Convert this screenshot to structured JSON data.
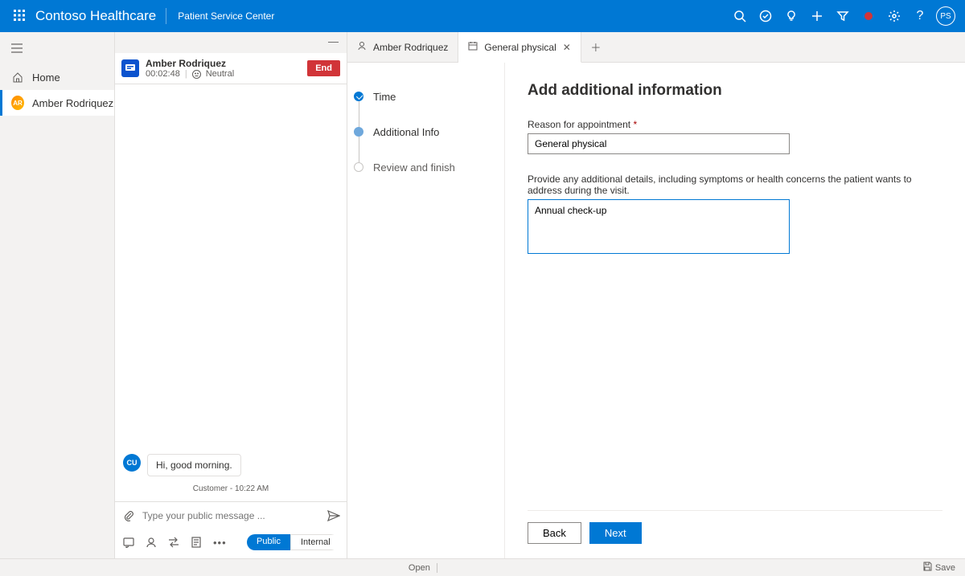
{
  "header": {
    "brand": "Contoso Healthcare",
    "subtitle": "Patient Service Center",
    "avatar": "PS"
  },
  "nav": {
    "home": "Home",
    "patient": "Amber Rodriquez",
    "patient_initials": "AR"
  },
  "chat": {
    "name": "Amber Rodriquez",
    "timer": "00:02:48",
    "sentiment": "Neutral",
    "end": "End",
    "msg_avatar": "CU",
    "msg_text": "Hi, good morning.",
    "msg_footer": "Customer - 10:22 AM",
    "placeholder": "Type your public message ...",
    "toggle_public": "Public",
    "toggle_internal": "Internal"
  },
  "tabs": {
    "t1": "Amber Rodriquez",
    "t2": "General physical"
  },
  "steps": {
    "s1": "Time",
    "s2": "Additional Info",
    "s3": "Review and finish"
  },
  "form": {
    "title": "Add additional information",
    "reason_label": "Reason for appointment",
    "reason_value": "General physical",
    "details_label": "Provide any additional details, including symptoms or health concerns the patient wants to address during the visit.",
    "details_value": "Annual check-up",
    "back": "Back",
    "next": "Next"
  },
  "footer": {
    "open": "Open",
    "save": "Save"
  }
}
